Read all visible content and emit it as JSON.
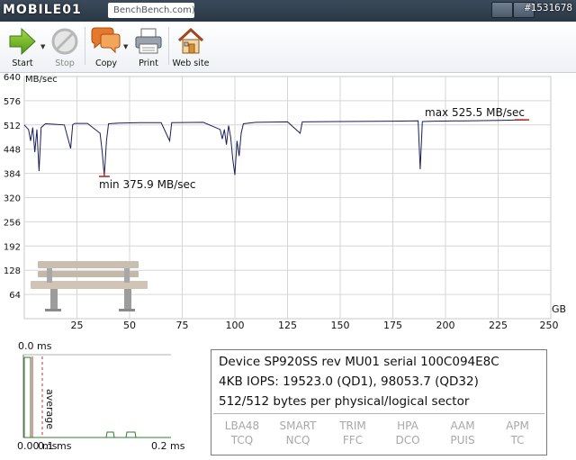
{
  "titlebar": {
    "brand": "MOBILE01",
    "title": "BenchBench.com)",
    "watermark": "#1531678"
  },
  "toolbar": {
    "buttons": [
      {
        "label": "Start",
        "icon": "arrow-right-icon",
        "enabled": true
      },
      {
        "label": "Stop",
        "icon": "stop-icon",
        "enabled": false
      },
      {
        "label": "Copy",
        "icon": "speech-bubbles-icon",
        "enabled": true
      },
      {
        "label": "Print",
        "icon": "printer-icon",
        "enabled": true
      },
      {
        "label": "Web site",
        "icon": "house-icon",
        "enabled": true
      }
    ]
  },
  "colors": {
    "line": "#1a1f5a",
    "marker": "#b02020",
    "grid": "#d6d6d6",
    "latency_green": "#2f7d2f",
    "latency_red": "#c03030"
  },
  "chart_data": [
    {
      "type": "line",
      "ylabel": "MB/sec",
      "xlabel": "GB",
      "y_ticks": [
        64,
        128,
        192,
        256,
        320,
        384,
        448,
        512,
        576,
        640
      ],
      "x_ticks": [
        25,
        50,
        75,
        100,
        125,
        150,
        175,
        200,
        225,
        250
      ],
      "xlim": [
        0,
        250
      ],
      "ylim": [
        0,
        640
      ],
      "grid": true,
      "annotations": {
        "max": "max 525.5 MB/sec",
        "min": "min 375.9 MB/sec"
      },
      "max_point": [
        238,
        525.5
      ],
      "min_point": [
        38,
        375.9
      ],
      "series": [
        {
          "x": [
            0,
            2,
            3,
            4,
            5,
            6,
            7,
            8,
            10,
            14,
            19,
            22,
            23,
            24,
            30,
            36,
            37,
            38,
            39,
            40,
            45,
            55,
            65,
            69,
            70,
            85,
            93,
            94,
            95,
            96,
            97,
            98,
            99,
            100,
            101,
            102,
            103,
            104,
            110,
            125,
            131,
            132,
            150,
            175,
            187,
            188,
            189,
            195,
            210,
            225,
            238
          ],
          "y": [
            512,
            500,
            470,
            505,
            440,
            500,
            390,
            505,
            515,
            514,
            512,
            450,
            513,
            516,
            516,
            490,
            440,
            375.9,
            470,
            515,
            517,
            518,
            518,
            470,
            518,
            519,
            500,
            475,
            500,
            460,
            510,
            480,
            420,
            380,
            470,
            430,
            490,
            515,
            519,
            520,
            490,
            520,
            521,
            522,
            523,
            395,
            521,
            522,
            523,
            524,
            525.5
          ]
        }
      ]
    },
    {
      "type": "line",
      "title": "",
      "x_tick_labels": [
        "0.00 ms",
        "0.1 ms",
        "0.2 ms"
      ],
      "y_top_label": "0.0 ms",
      "vertical_label": "average"
    }
  ],
  "info": {
    "line1": "Device SP920SS rev MU01 serial 100C094E8C",
    "line2": "4KB IOPS: 19523.0 (QD1), 98053.7 (QD32)",
    "line3": "512/512 bytes per physical/logical sector",
    "features": [
      {
        "top": "LBA48",
        "bottom": "TCQ"
      },
      {
        "top": "SMART",
        "bottom": "NCQ"
      },
      {
        "top": "TRIM",
        "bottom": "FFC"
      },
      {
        "top": "HPA",
        "bottom": "DCO"
      },
      {
        "top": "AAM",
        "bottom": "PUIS"
      },
      {
        "top": "APM",
        "bottom": "TC"
      }
    ]
  }
}
